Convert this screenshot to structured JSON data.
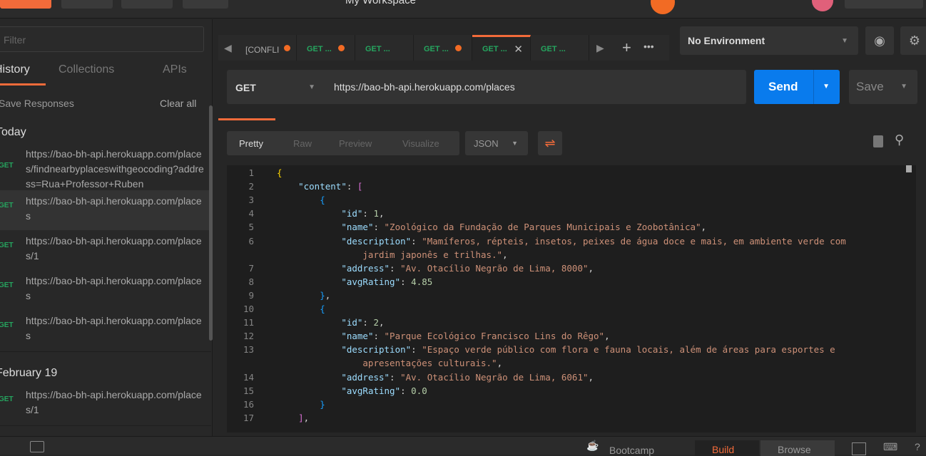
{
  "header": {
    "workspace": "My Workspace"
  },
  "sidebar": {
    "filter_placeholder": "Filter",
    "tabs": [
      "History",
      "Collections",
      "APIs"
    ],
    "save_responses": "Save Responses",
    "clear_all": "Clear all",
    "groups": [
      {
        "label": "Today",
        "items": [
          {
            "method": "GET",
            "url": "https://bao-bh-api.herokuapp.com/places/findnearbyplaceswithgeocoding?address=Rua+Professor+Ruben"
          },
          {
            "method": "GET",
            "url": "https://bao-bh-api.herokuapp.com/places"
          },
          {
            "method": "GET",
            "url": "https://bao-bh-api.herokuapp.com/places/1"
          },
          {
            "method": "GET",
            "url": "https://bao-bh-api.herokuapp.com/places"
          },
          {
            "method": "GET",
            "url": "https://bao-bh-api.herokuapp.com/places"
          }
        ]
      },
      {
        "label": "February 19",
        "items": [
          {
            "method": "GET",
            "url": "https://bao-bh-api.herokuapp.com/places/1"
          }
        ]
      }
    ]
  },
  "tabs": [
    {
      "label": "[CONFLI",
      "dirty": true
    },
    {
      "label": "GET ...",
      "dirty": true
    },
    {
      "label": "GET ...",
      "dirty": false
    },
    {
      "label": "GET ...",
      "dirty": true
    },
    {
      "label": "GET ...",
      "dirty": false,
      "active": true
    },
    {
      "label": "GET ...",
      "dirty": false
    }
  ],
  "environment": "No Environment",
  "request": {
    "method": "GET",
    "url": "https://bao-bh-api.herokuapp.com/places",
    "send": "Send",
    "save": "Save"
  },
  "response": {
    "views": [
      "Pretty",
      "Raw",
      "Preview",
      "Visualize"
    ],
    "format": "JSON"
  },
  "code": [
    [
      [
        "b1",
        "{"
      ]
    ],
    [
      [
        "",
        "    "
      ],
      [
        "k",
        "\"content\""
      ],
      [
        "",
        ": "
      ],
      [
        "b2",
        "["
      ]
    ],
    [
      [
        "",
        "        "
      ],
      [
        "b3",
        "{"
      ]
    ],
    [
      [
        "",
        "            "
      ],
      [
        "k",
        "\"id\""
      ],
      [
        "",
        ": "
      ],
      [
        "n",
        "1"
      ],
      [
        "",
        ","
      ]
    ],
    [
      [
        "",
        "            "
      ],
      [
        "k",
        "\"name\""
      ],
      [
        "",
        ": "
      ],
      [
        "s",
        "\"Zoológico da Fundação de Parques Municipais e Zoobotânica\""
      ],
      [
        "",
        ","
      ]
    ],
    [
      [
        "",
        "            "
      ],
      [
        "k",
        "\"description\""
      ],
      [
        "",
        ": "
      ],
      [
        "s",
        "\"Mamíferos, répteis, insetos, peixes de água doce e mais, em ambiente verde com"
      ]
    ],
    [
      [
        "s",
        "                jardim japonês e trilhas.\""
      ],
      [
        "",
        ","
      ]
    ],
    [
      [
        "",
        "            "
      ],
      [
        "k",
        "\"address\""
      ],
      [
        "",
        ": "
      ],
      [
        "s",
        "\"Av. Otacílio Negrão de Lima, 8000\""
      ],
      [
        "",
        ","
      ]
    ],
    [
      [
        "",
        "            "
      ],
      [
        "k",
        "\"avgRating\""
      ],
      [
        "",
        ": "
      ],
      [
        "n",
        "4.85"
      ]
    ],
    [
      [
        "",
        "        "
      ],
      [
        "b3",
        "}"
      ],
      [
        "",
        ","
      ]
    ],
    [
      [
        "",
        "        "
      ],
      [
        "b3",
        "{"
      ]
    ],
    [
      [
        "",
        "            "
      ],
      [
        "k",
        "\"id\""
      ],
      [
        "",
        ": "
      ],
      [
        "n",
        "2"
      ],
      [
        "",
        ","
      ]
    ],
    [
      [
        "",
        "            "
      ],
      [
        "k",
        "\"name\""
      ],
      [
        "",
        ": "
      ],
      [
        "s",
        "\"Parque Ecológico Francisco Lins do Rêgo\""
      ],
      [
        "",
        ","
      ]
    ],
    [
      [
        "",
        "            "
      ],
      [
        "k",
        "\"description\""
      ],
      [
        "",
        ": "
      ],
      [
        "s",
        "\"Espaço verde público com flora e fauna locais, além de áreas para esportes e"
      ]
    ],
    [
      [
        "s",
        "                apresentações culturais.\""
      ],
      [
        "",
        ","
      ]
    ],
    [
      [
        "",
        "            "
      ],
      [
        "k",
        "\"address\""
      ],
      [
        "",
        ": "
      ],
      [
        "s",
        "\"Av. Otacílio Negrão de Lima, 6061\""
      ],
      [
        "",
        ","
      ]
    ],
    [
      [
        "",
        "            "
      ],
      [
        "k",
        "\"avgRating\""
      ],
      [
        "",
        ": "
      ],
      [
        "n",
        "0.0"
      ]
    ],
    [
      [
        "",
        "        "
      ],
      [
        "b3",
        "}"
      ]
    ],
    [
      [
        "",
        "    "
      ],
      [
        "b2",
        "]"
      ],
      [
        "",
        ","
      ]
    ]
  ],
  "line_numbers": [
    "1",
    "2",
    "3",
    "4",
    "5",
    "6",
    "",
    "7",
    "8",
    "9",
    "10",
    "11",
    "12",
    "13",
    "",
    "14",
    "15",
    "16",
    "17"
  ],
  "status": {
    "bootcamp": "Bootcamp",
    "build": "Build",
    "browse": "Browse"
  }
}
